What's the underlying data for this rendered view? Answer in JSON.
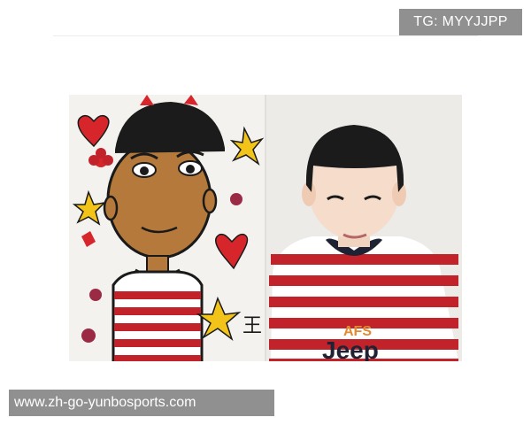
{
  "watermark": {
    "badge_text": "TG: MYYJJPP",
    "url_text": "www.zh-go-yunbosports.com"
  },
  "photo": {
    "drawing_caption": "王",
    "shirt_print_top": "AFS",
    "shirt_print_bottom": "Jeep"
  },
  "colors": {
    "overlay": "#7a7a7a",
    "stripe_red": "#c2232b",
    "hair": "#1b1b1b",
    "skin_drawing": "#b5793b",
    "star_yellow": "#f2c318",
    "heart_red": "#d6262b"
  }
}
